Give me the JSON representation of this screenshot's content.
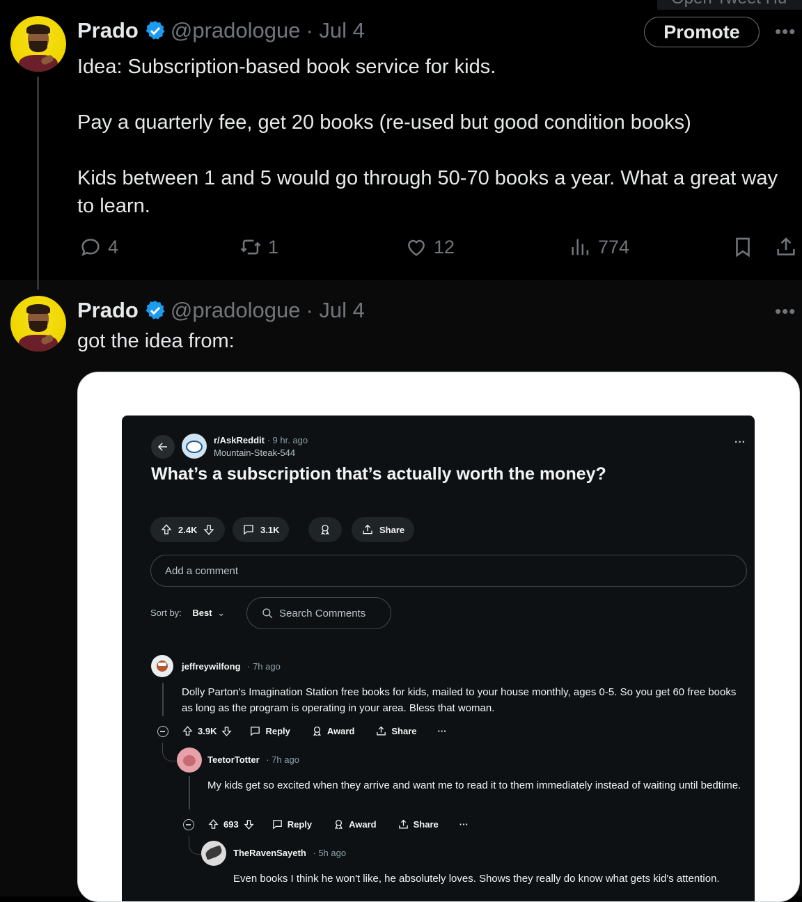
{
  "top_overlay_text": "Open Tweet Hu",
  "tweets": [
    {
      "name": "Prado",
      "handle": "@pradologue",
      "date": "· Jul 4",
      "promote_label": "Promote",
      "paragraphs": [
        "Idea: Subscription-based book service for kids.",
        "Pay a quarterly fee, get 20 books (re-used but good condition books)",
        "Kids between 1 and 5 would go through 50-70 books a year. What a great way to learn."
      ],
      "stats": {
        "replies": "4",
        "retweets": "1",
        "likes": "12",
        "views": "774"
      }
    },
    {
      "name": "Prado",
      "handle": "@pradologue",
      "date": "· Jul 4",
      "text": "got the idea from:"
    }
  ],
  "reddit": {
    "subreddit": "r/AskReddit",
    "time": "· 9 hr. ago",
    "author": "Mountain-Steak-544",
    "title": "What’s a subscription that’s actually worth the money?",
    "upvotes": "2.4K",
    "comments": "3.1K",
    "share_label": "Share",
    "comment_placeholder": "Add a comment",
    "sort_label": "Sort by:",
    "sort_value": "Best",
    "search_placeholder": "Search Comments",
    "comment_list": [
      {
        "user": "jeffreywilfong",
        "time": "· 7h ago",
        "text": "Dolly Parton's Imagination Station free books for kids, mailed to your house monthly, ages 0-5. So you get 60 free books as long as the program is operating in your area. Bless that woman.",
        "score": "3.9K",
        "reply": "Reply",
        "award": "Award",
        "share": "Share"
      },
      {
        "user": "TeetorTotter",
        "time": "· 7h ago",
        "text": "My kids get so excited when they arrive and want me to read it to them immediately instead of waiting until bedtime.",
        "score": "693",
        "reply": "Reply",
        "award": "Award",
        "share": "Share"
      },
      {
        "user": "TheRavenSayeth",
        "time": "· 5h ago",
        "text": "Even books I think he won't like, he absolutely loves. Shows they really do know what gets kid's attention."
      }
    ]
  },
  "colors": {
    "accent_blue": "#1d9bf0",
    "muted": "#71767b",
    "reddit_bg": "#0e1113"
  }
}
